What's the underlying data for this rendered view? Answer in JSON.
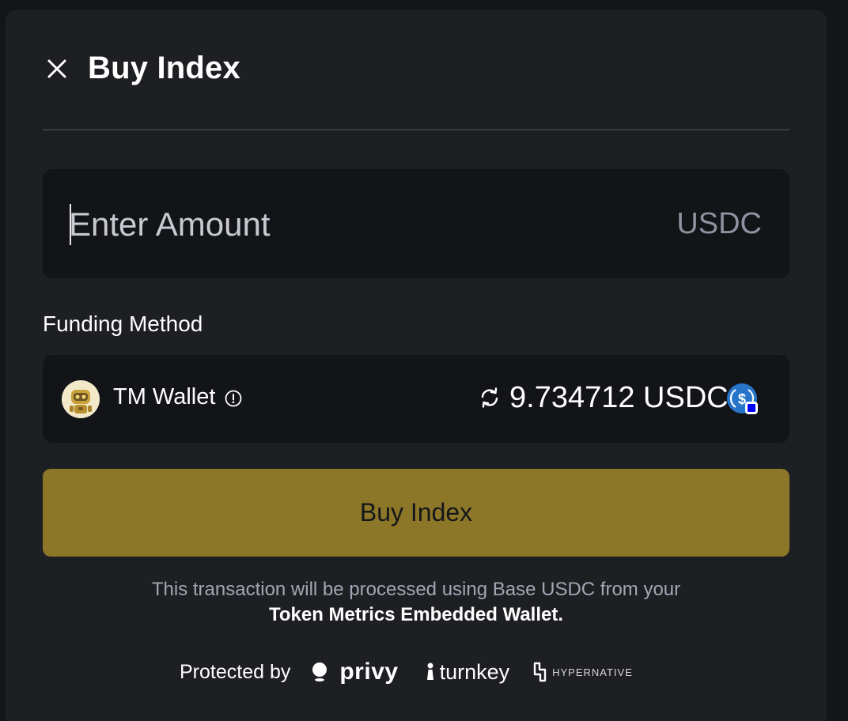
{
  "modal": {
    "title": "Buy Index",
    "close_icon": "close-icon"
  },
  "amount": {
    "placeholder": "Enter Amount",
    "value": "",
    "currency": "USDC"
  },
  "funding": {
    "label": "Funding Method",
    "wallet_name": "TM Wallet",
    "wallet_avatar_icon": "robot-avatar-icon",
    "info_icon": "info-icon",
    "refresh_icon": "refresh-icon",
    "balance": "9.734712 USDC",
    "token_icon": "usdc-base-icon"
  },
  "buy_button": {
    "label": "Buy Index"
  },
  "note": {
    "line1": "This transaction will be processed using Base USDC from your",
    "line2": "Token Metrics Embedded Wallet."
  },
  "footer": {
    "protected_by": "Protected by",
    "providers": [
      "privy",
      "turnkey",
      "HYPERNATIVE"
    ]
  },
  "colors": {
    "background": "#1e1f23",
    "input_background": "#131418",
    "accent_button": "#8c7728",
    "muted_text": "#a5a6b3",
    "usdc_blue": "#2775ca"
  }
}
